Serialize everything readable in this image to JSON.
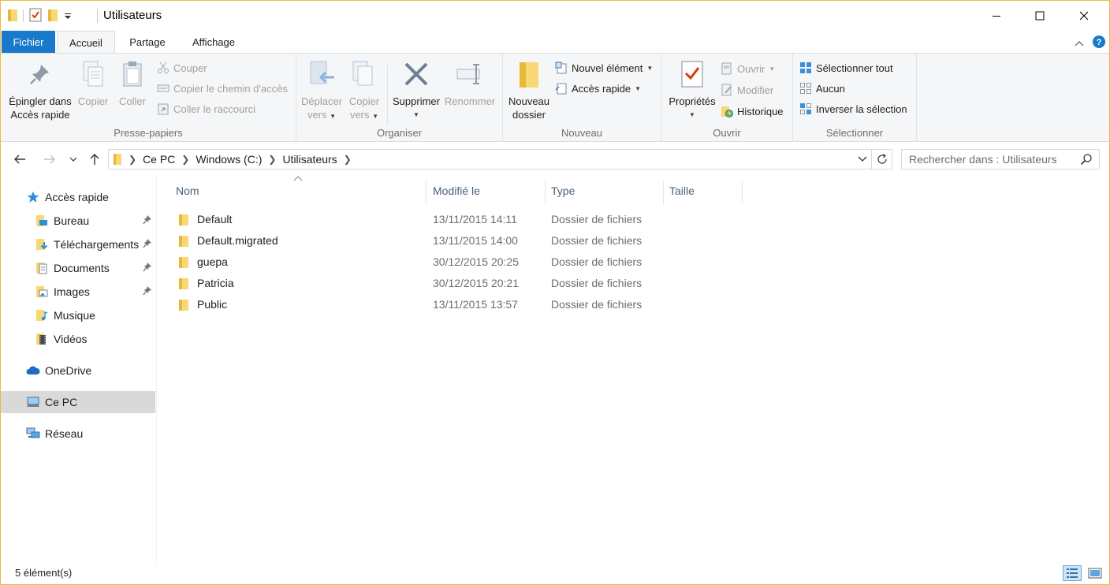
{
  "window": {
    "title": "Utilisateurs"
  },
  "ribbon_tabs": {
    "file": "Fichier",
    "home": "Accueil",
    "share": "Partage",
    "view": "Affichage"
  },
  "clipboard": {
    "label": "Presse-papiers",
    "pin_line1": "Épingler dans",
    "pin_line2": "Accès rapide",
    "copy": "Copier",
    "paste": "Coller",
    "cut": "Couper",
    "copy_path": "Copier le chemin d'accès",
    "paste_shortcut": "Coller le raccourci"
  },
  "organize": {
    "label": "Organiser",
    "move_line1": "Déplacer",
    "move_line2": "vers",
    "copyto_line1": "Copier",
    "copyto_line2": "vers",
    "delete": "Supprimer",
    "rename": "Renommer"
  },
  "new": {
    "label": "Nouveau",
    "folder_line1": "Nouveau",
    "folder_line2": "dossier",
    "new_item": "Nouvel élément",
    "easy_access": "Accès rapide"
  },
  "open": {
    "label": "Ouvrir",
    "properties": "Propriétés",
    "open": "Ouvrir",
    "edit": "Modifier",
    "history": "Historique"
  },
  "select": {
    "label": "Sélectionner",
    "select_all": "Sélectionner tout",
    "select_none": "Aucun",
    "invert": "Inverser la sélection"
  },
  "address": {
    "crumbs": [
      "Ce PC",
      "Windows (C:)",
      "Utilisateurs"
    ]
  },
  "search": {
    "placeholder": "Rechercher dans : Utilisateurs"
  },
  "nav": {
    "quick_access": "Accès rapide",
    "items": [
      "Bureau",
      "Téléchargements",
      "Documents",
      "Images",
      "Musique",
      "Vidéos"
    ],
    "onedrive": "OneDrive",
    "this_pc": "Ce PC",
    "network": "Réseau"
  },
  "columns": {
    "name": "Nom",
    "modified": "Modifié le",
    "type": "Type",
    "size": "Taille"
  },
  "files": [
    {
      "name": "Default",
      "modified": "13/11/2015 14:11",
      "type": "Dossier de fichiers"
    },
    {
      "name": "Default.migrated",
      "modified": "13/11/2015 14:00",
      "type": "Dossier de fichiers"
    },
    {
      "name": "guepa",
      "modified": "30/12/2015 20:25",
      "type": "Dossier de fichiers"
    },
    {
      "name": "Patricia",
      "modified": "30/12/2015 20:21",
      "type": "Dossier de fichiers"
    },
    {
      "name": "Public",
      "modified": "13/11/2015 13:57",
      "type": "Dossier de fichiers"
    }
  ],
  "status": {
    "count": "5 élément(s)"
  },
  "colors": {
    "accent": "#1979ca",
    "folder": "#f8d775",
    "window_border": "#f0b840"
  }
}
